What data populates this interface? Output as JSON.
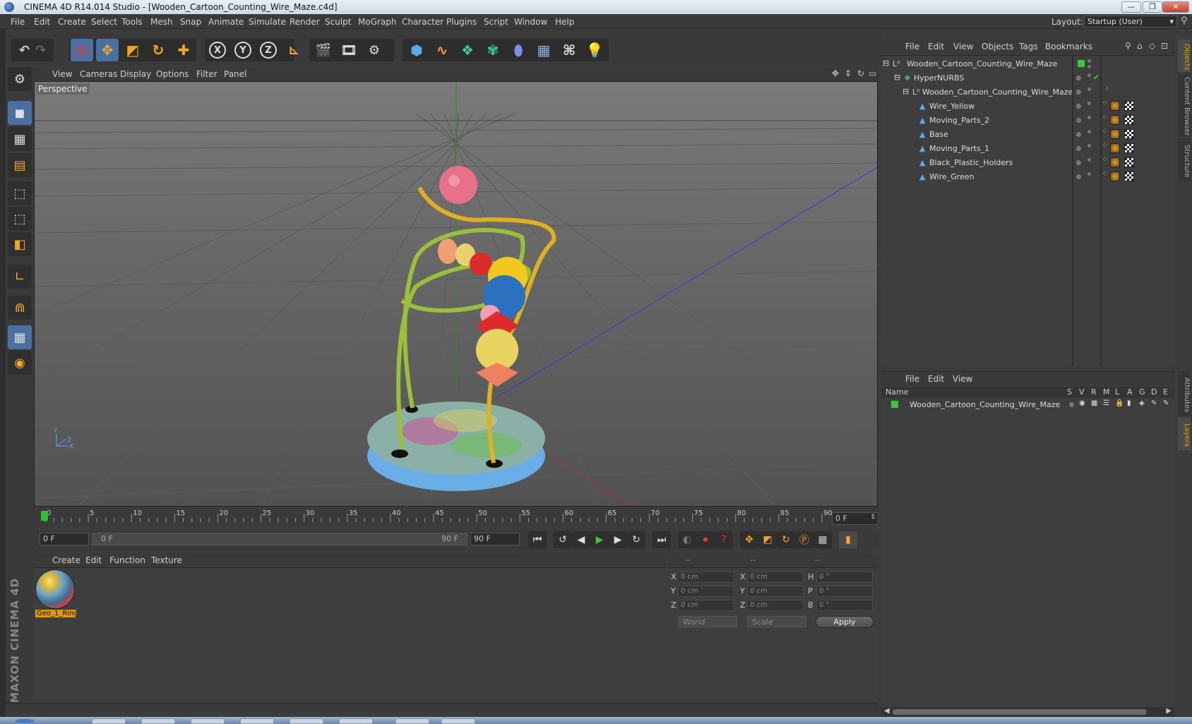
{
  "window": {
    "title": "CINEMA 4D R14.014 Studio - [Wooden_Cartoon_Counting_Wire_Maze.c4d]",
    "minimize": "—",
    "maximize": "❐",
    "close": "✕"
  },
  "menubar": {
    "items": [
      "File",
      "Edit",
      "Create",
      "Select",
      "Tools",
      "Mesh",
      "Snap",
      "Animate",
      "Simulate",
      "Render",
      "Sculpt",
      "MoGraph",
      "Character",
      "Plugins",
      "Script",
      "Window",
      "Help"
    ],
    "layout_label": "Layout:",
    "layout_value": "Startup (User)"
  },
  "toolbar": {
    "axis_x": "X",
    "axis_y": "Y",
    "axis_z": "Z"
  },
  "viewport": {
    "menu": [
      "View",
      "Cameras",
      "Display",
      "Options",
      "Filter",
      "Panel"
    ],
    "label": "Perspective",
    "axis_y": "Y",
    "axis_z": "Z",
    "axis_x": "X"
  },
  "timeline": {
    "ticks": [
      "0",
      "5",
      "10",
      "15",
      "20",
      "25",
      "30",
      "35",
      "40",
      "45",
      "50",
      "55",
      "60",
      "65",
      "70",
      "75",
      "80",
      "85",
      "90"
    ],
    "current_frame": "0 F"
  },
  "transport": {
    "start_field": "0 F",
    "range_start": "0 F",
    "range_end": "90 F",
    "end_field": "90 F"
  },
  "material_manager": {
    "menu": [
      "Create",
      "Edit",
      "Function",
      "Texture"
    ],
    "materials": [
      {
        "name": "Geo_1_Ring"
      }
    ]
  },
  "coordinates": {
    "header": [
      "--",
      "--",
      "--"
    ],
    "rows": [
      {
        "pos_label": "X",
        "pos_value": "0 cm",
        "size_label": "X",
        "size_value": "0 cm",
        "rot_label": "H",
        "rot_value": "0 °"
      },
      {
        "pos_label": "Y",
        "pos_value": "0 cm",
        "size_label": "Y",
        "size_value": "0 cm",
        "rot_label": "P",
        "rot_value": "0 °"
      },
      {
        "pos_label": "Z",
        "pos_value": "0 cm",
        "size_label": "Z",
        "size_value": "0 cm",
        "rot_label": "B",
        "rot_value": "0 °"
      }
    ],
    "world": "World",
    "scale": "Scale",
    "apply": "Apply"
  },
  "object_manager": {
    "menu": [
      "File",
      "Edit",
      "View",
      "Objects",
      "Tags",
      "Bookmarks"
    ],
    "objects": [
      {
        "name": "Wooden_Cartoon_Counting_Wire_Maze",
        "level": 0,
        "type": "null"
      },
      {
        "name": "HyperNURBS",
        "level": 1,
        "type": "hypernurbs"
      },
      {
        "name": "Wooden_Cartoon_Counting_Wire_Maze",
        "level": 2,
        "type": "null"
      },
      {
        "name": "Wire_Yellow",
        "level": 3,
        "type": "polygon"
      },
      {
        "name": "Moving_Parts_2",
        "level": 3,
        "type": "polygon"
      },
      {
        "name": "Base",
        "level": 3,
        "type": "polygon"
      },
      {
        "name": "Moving_Parts_1",
        "level": 3,
        "type": "polygon"
      },
      {
        "name": "Black_Plastic_Holders",
        "level": 3,
        "type": "polygon"
      },
      {
        "name": "Wire_Green",
        "level": 3,
        "type": "polygon"
      }
    ]
  },
  "layer_manager": {
    "menu": [
      "File",
      "Edit",
      "View"
    ],
    "columns": [
      "Name",
      "S",
      "V",
      "R",
      "M",
      "L",
      "A",
      "G",
      "D",
      "E"
    ],
    "layers": [
      {
        "name": "Wooden_Cartoon_Counting_Wire_Maze",
        "color": "#3cc83c"
      }
    ]
  },
  "side_tabs": {
    "objects": "Objects",
    "content_browser": "Content Browser",
    "structure": "Structure",
    "attributes": "Attributes",
    "layers": "Layers"
  },
  "branding": {
    "maxon": "MAXON CINEMA 4D"
  },
  "colors": {
    "accent": "#4a6fa1",
    "highlight": "#e09a00",
    "layer_green": "#3cc83c"
  }
}
